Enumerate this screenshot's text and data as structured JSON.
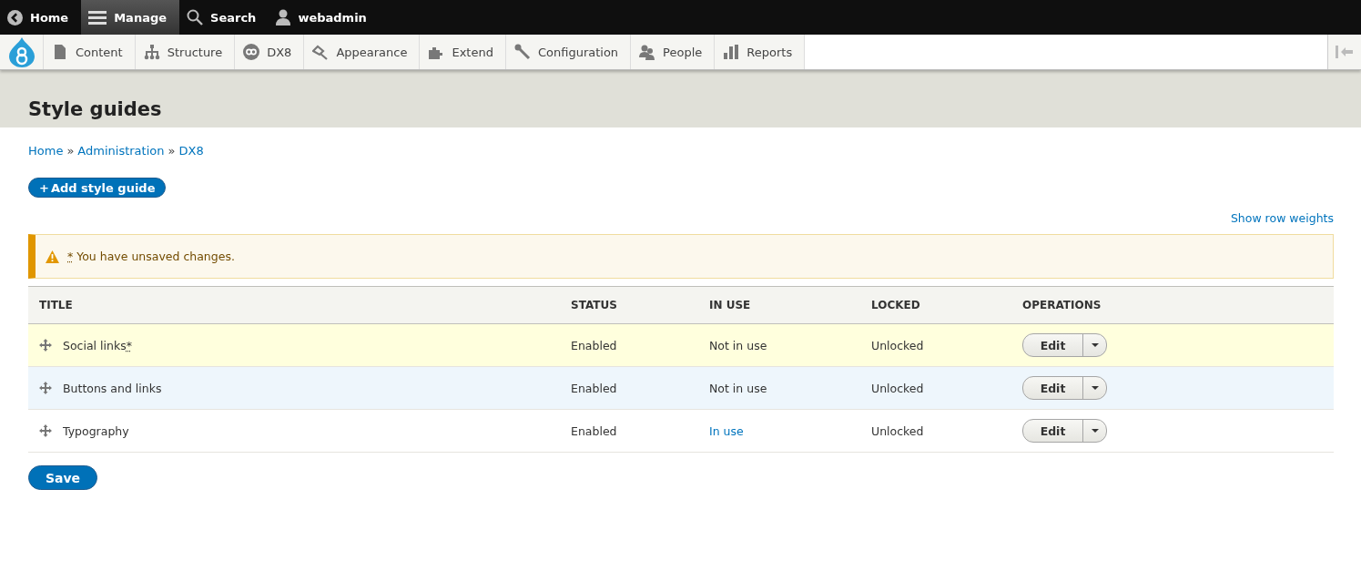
{
  "toolbar": {
    "items": [
      {
        "label": "Home",
        "selected": false
      },
      {
        "label": "Manage",
        "selected": true
      },
      {
        "label": "Search",
        "selected": false
      },
      {
        "label": "webadmin",
        "selected": false
      }
    ]
  },
  "tray": {
    "items": [
      {
        "label": "Content"
      },
      {
        "label": "Structure"
      },
      {
        "label": "DX8"
      },
      {
        "label": "Appearance"
      },
      {
        "label": "Extend"
      },
      {
        "label": "Configuration"
      },
      {
        "label": "People"
      },
      {
        "label": "Reports"
      }
    ]
  },
  "page_title": "Style guides",
  "breadcrumb": [
    "Home",
    "Administration",
    "DX8"
  ],
  "breadcrumb_separator": "»",
  "add_button": {
    "icon": "+",
    "label": "Add style guide"
  },
  "row_weights_link": "Show row weights",
  "message": {
    "marker": "*",
    "text": "You have unsaved changes."
  },
  "table": {
    "columns": [
      "TITLE",
      "STATUS",
      "IN USE",
      "LOCKED",
      "OPERATIONS"
    ],
    "rows": [
      {
        "title": "Social links",
        "marker": "*",
        "changed": true,
        "hovered": false,
        "status": "Enabled",
        "in_use": "Not in use",
        "in_use_link": false,
        "locked": "Unlocked",
        "operation": "Edit"
      },
      {
        "title": "Buttons and links",
        "changed": false,
        "hovered": true,
        "status": "Enabled",
        "in_use": "Not in use",
        "in_use_link": false,
        "locked": "Unlocked",
        "operation": "Edit"
      },
      {
        "title": "Typography",
        "changed": false,
        "hovered": false,
        "status": "Enabled",
        "in_use": "In use",
        "in_use_link": true,
        "locked": "Unlocked",
        "operation": "Edit"
      }
    ]
  },
  "save_button": "Save"
}
